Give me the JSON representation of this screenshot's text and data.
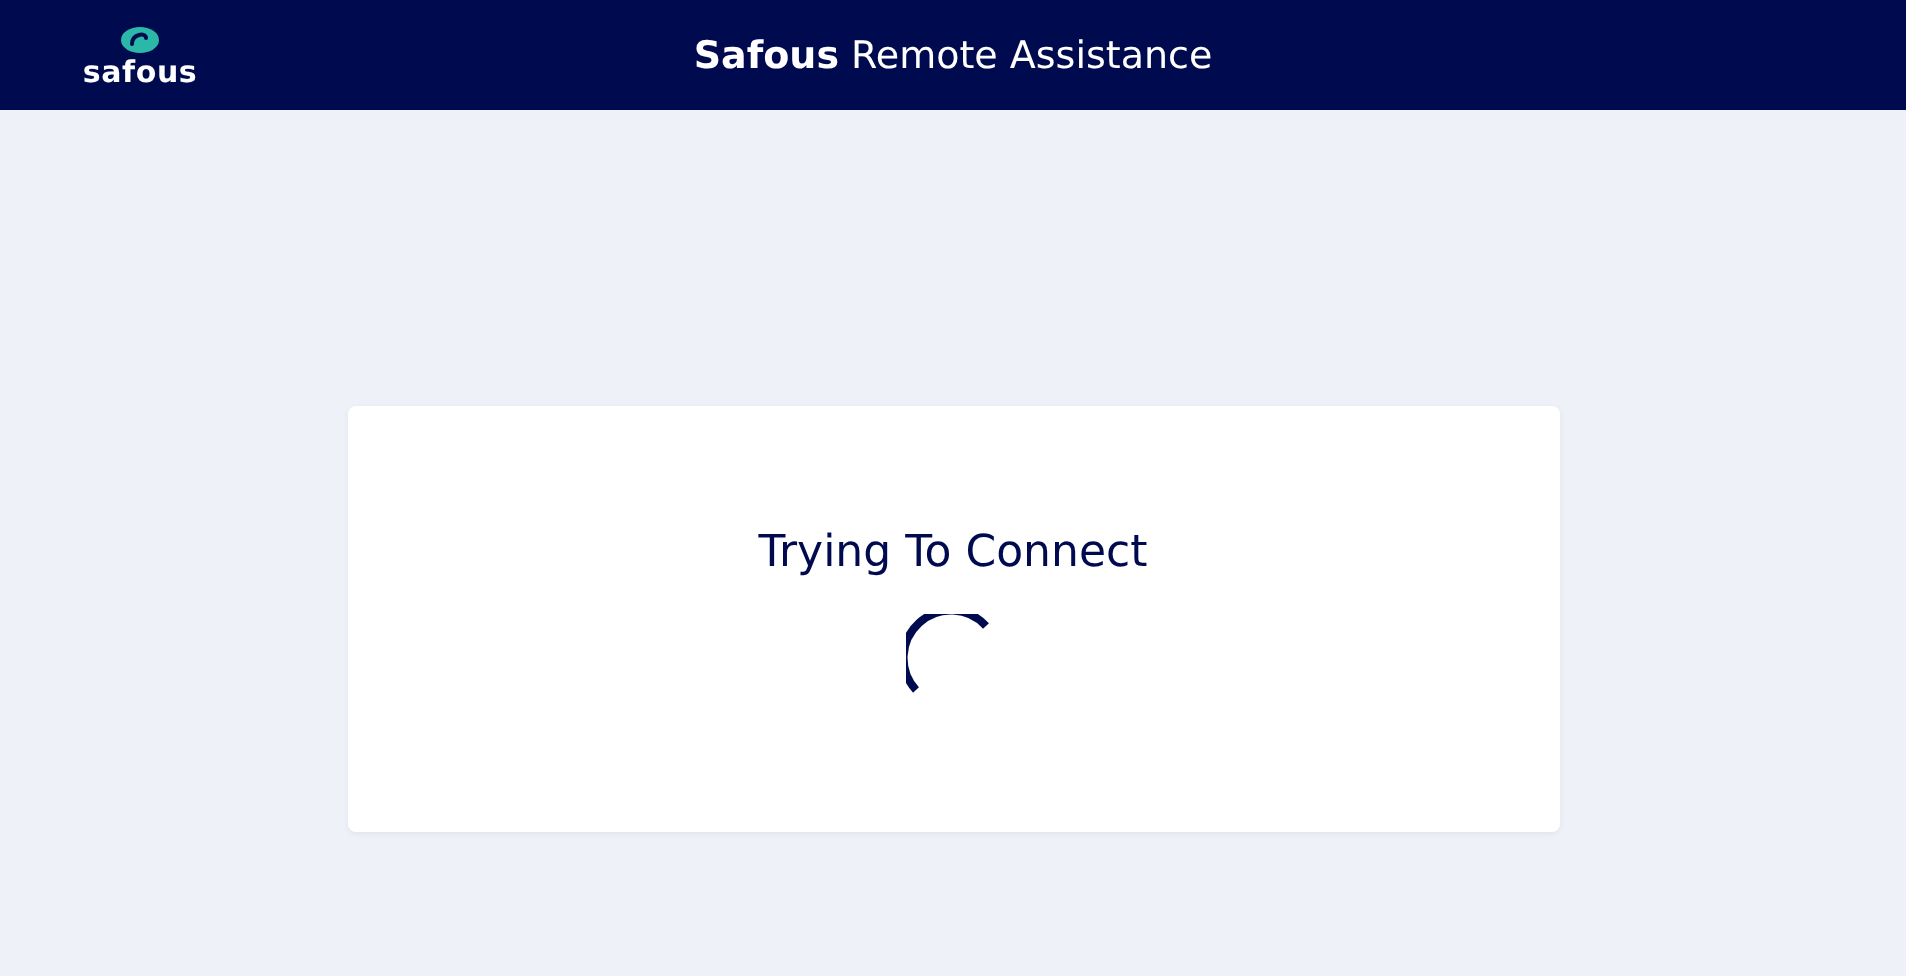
{
  "header": {
    "logo_text": "safous",
    "title": "**Safous** Remote Assistance"
  },
  "card": {
    "message": "Trying To Connect"
  }
}
